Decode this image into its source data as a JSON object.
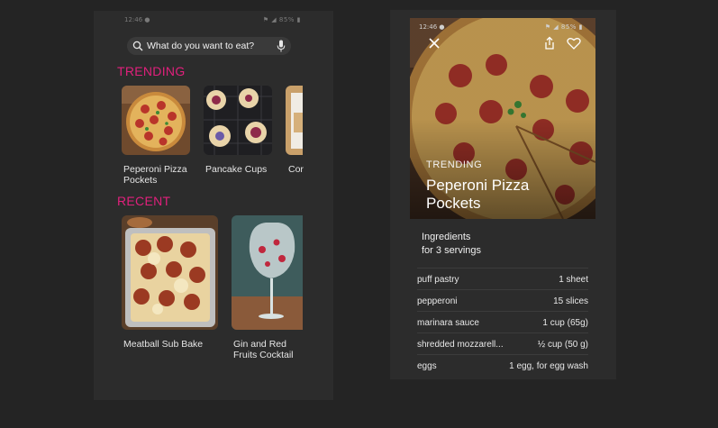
{
  "home": {
    "status_time": "12:46 ●",
    "status_icons": "⚑ ◢ 85% ▮",
    "search": {
      "placeholder": "What do you want to eat?",
      "icon": "search-icon",
      "mic_icon": "microphone-icon"
    },
    "trending": {
      "title": "TRENDING",
      "items": [
        {
          "label": "Peperoni Pizza Pockets"
        },
        {
          "label": "Pancake Cups"
        },
        {
          "label": "Cor"
        }
      ]
    },
    "recent": {
      "title": "RECENT",
      "items": [
        {
          "label": "Meatball Sub Bake"
        },
        {
          "label": "Gin and Red Fruits Cocktail"
        }
      ]
    }
  },
  "detail": {
    "status_time": "12:46 ●",
    "status_icons": "⚑ ◢ 85% ▮",
    "kicker": "TRENDING",
    "title": "Peperoni Pizza Pockets",
    "close_icon": "close-icon",
    "share_icon": "share-icon",
    "favorite_icon": "heart-icon",
    "ingredients_heading": "Ingredients",
    "servings": "for 3 servings",
    "ingredients": [
      {
        "name": "puff pastry",
        "qty": "1 sheet"
      },
      {
        "name": "pepperoni",
        "qty": "15 slices"
      },
      {
        "name": "marinara sauce",
        "qty": "1 cup (65g)"
      },
      {
        "name": "shredded mozzarell...",
        "qty": "½ cup  (50 g)"
      },
      {
        "name": "eggs",
        "qty": "1 egg, for egg wash"
      }
    ]
  },
  "colors": {
    "accent": "#e0207c",
    "background": "#242424",
    "phone": "#2c2c2c"
  }
}
